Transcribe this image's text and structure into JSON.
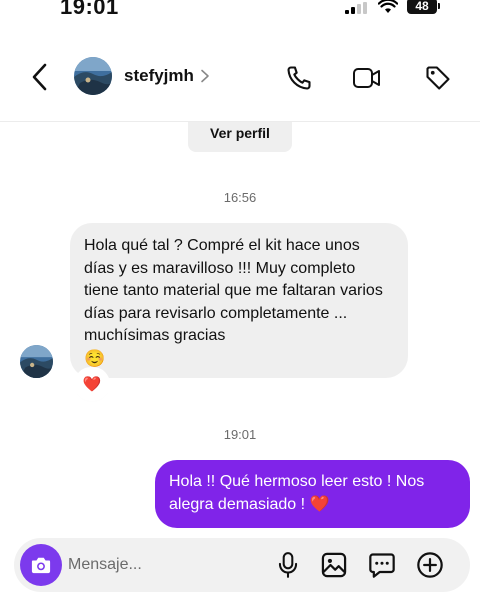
{
  "status_bar": {
    "time": "19:01",
    "battery": "48"
  },
  "header": {
    "username": "stefyjmh",
    "icons": [
      "back-arrow-icon",
      "chevron-right-icon",
      "phone-icon",
      "video-camera-icon",
      "tag-icon"
    ]
  },
  "conversation": {
    "view_profile_label": "Ver perfil",
    "timestamp_1": "16:56",
    "incoming_message": "Hola qué tal ? Compré el kit hace unos días y es maravilloso !!! Muy completo tiene tanto material que me faltaran varios días para revisarlo completamente ... muchísimas gracias",
    "incoming_emoji": "☺️",
    "reaction": "❤️",
    "timestamp_2": "19:01",
    "outgoing_message": "Hola !! Qué hermoso leer esto ! Nos alegra demasiado !",
    "outgoing_emoji": "❤️"
  },
  "composer": {
    "placeholder": "Mensaje...",
    "icons": [
      "camera-icon",
      "microphone-icon",
      "gallery-icon",
      "sticker-icon",
      "add-icon"
    ]
  },
  "colors": {
    "accent_purple": "#8024e9",
    "camera_button": "#7c3aed",
    "bubble_gray": "#efefef",
    "heart_red": "#e0245e"
  }
}
